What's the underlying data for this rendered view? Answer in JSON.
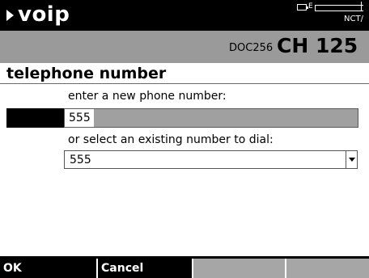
{
  "header": {
    "title": "voip",
    "status_e": "E",
    "status_nct": "NCT/"
  },
  "channel": {
    "doc": "DOC256",
    "ch": "CH 125"
  },
  "section": {
    "heading": "telephone number"
  },
  "new_number": {
    "label": "enter a new phone number:",
    "value": "555"
  },
  "existing_number": {
    "label": "or select an existing number to dial:",
    "selected": "555"
  },
  "softkeys": [
    "OK",
    "Cancel",
    "",
    ""
  ]
}
